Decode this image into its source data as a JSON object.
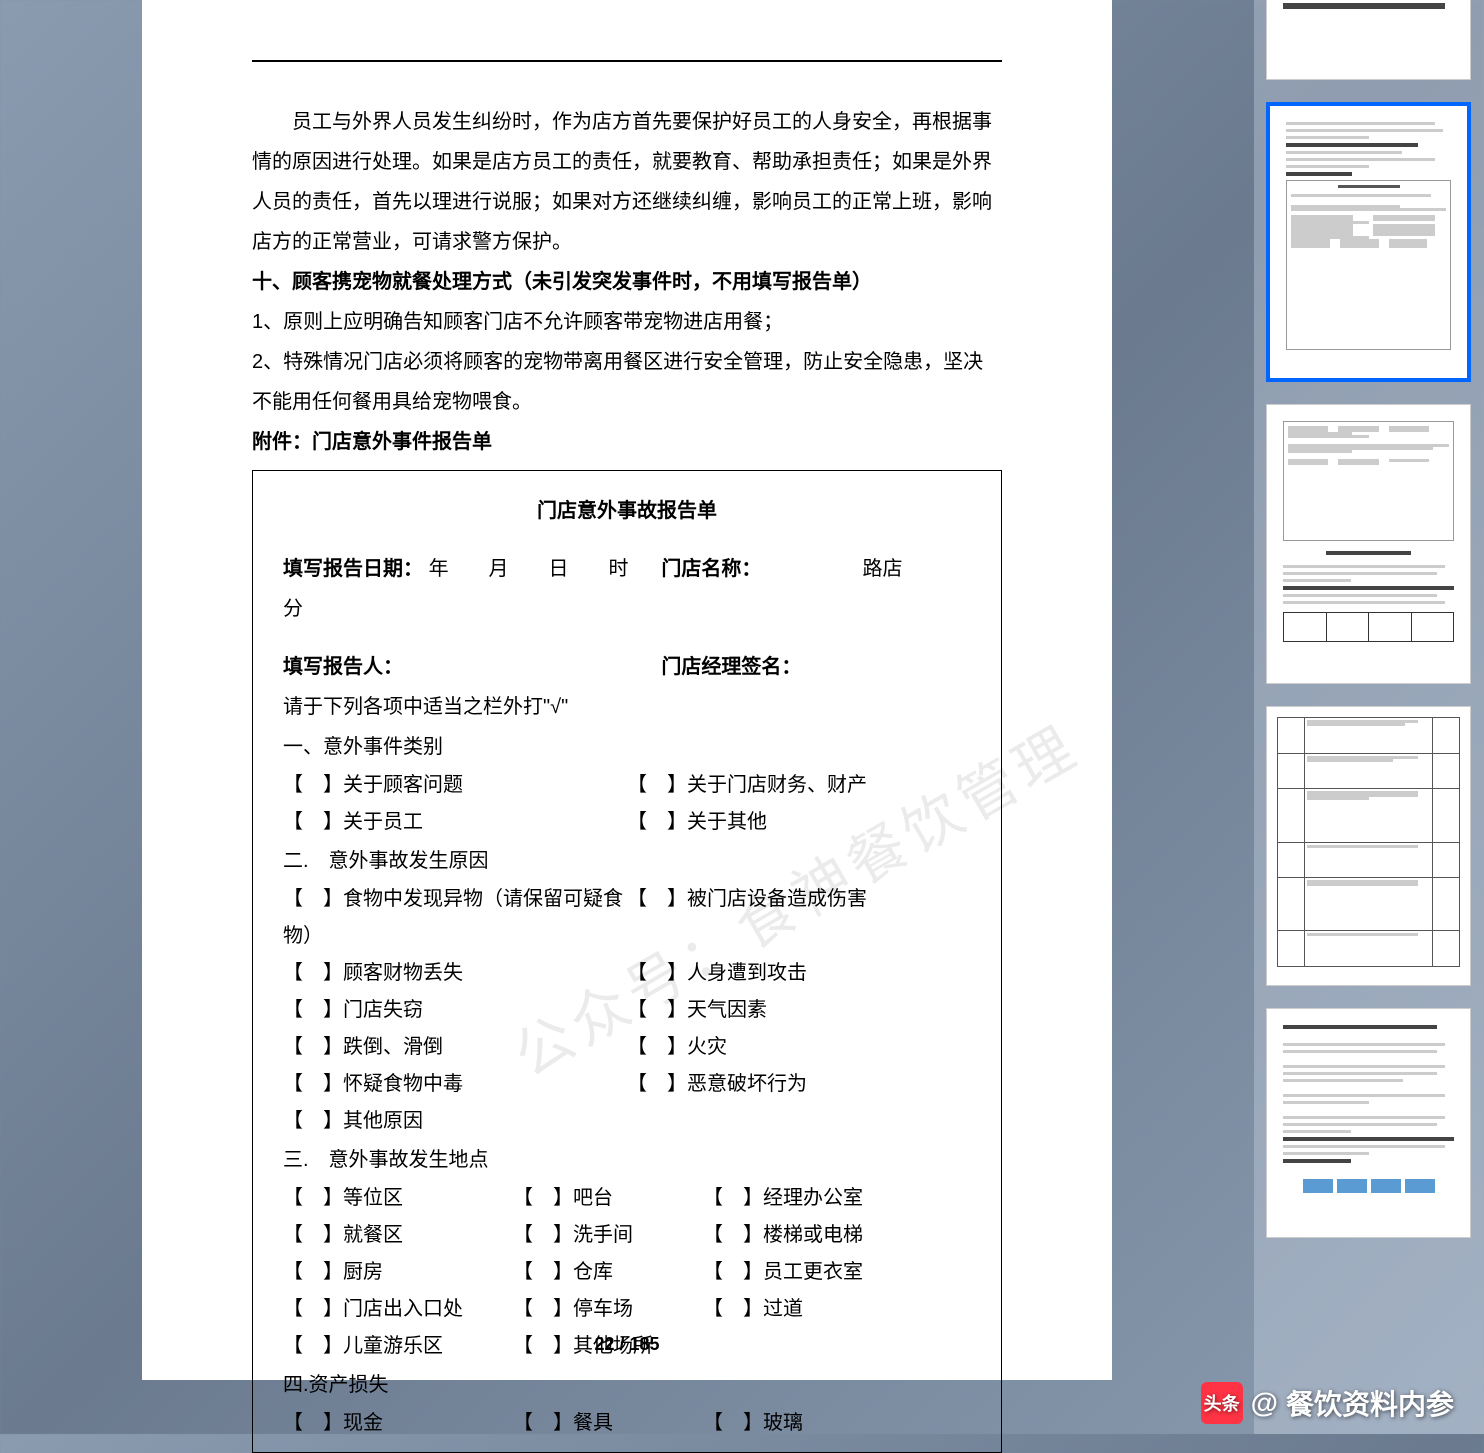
{
  "page": {
    "paragraph1": "员工与外界人员发生纠纷时，作为店方首先要保护好员工的人身安全，再根据事情的原因进行处理。如果是店方员工的责任，就要教育、帮助承担责任；如果是外界人员的责任，首先以理进行说服；如果对方还继续纠缠，影响员工的正常上班，影响店方的正常营业，可请求警方保护。",
    "heading10": "十、顾客携宠物就餐处理方式（未引发突发事件时，不用填写报告单）",
    "item1": "1、原则上应明确告知顾客门店不允许顾客带宠物进店用餐；",
    "item2": "2、特殊情况门店必须将顾客的宠物带离用餐区进行安全管理，防止安全隐患，坚决不能用任何餐用具给宠物喂食。",
    "attach_label": "附件：门店意外事件报告单",
    "form": {
      "title": "门店意外事故报告单",
      "date_label": "填写报告日期：",
      "date_fields": "年　　月　　日　　时　分",
      "store_label": "门店名称：",
      "store_suffix": "路店",
      "reporter_label": "填写报告人：",
      "manager_label": "门店经理签名：",
      "instruction": "请于下列各项中适当之栏外打\"√\"",
      "sec1": "一、意外事件类别",
      "s1a": "【　】关于顾客问题",
      "s1b": "【　】关于门店财务、财产",
      "s1c": "【　】关于员工",
      "s1d": "【　】关于其他",
      "sec2": "二.　意外事故发生原因",
      "s2a": "【　】食物中发现异物（请保留可疑食物）",
      "s2b": "【　】被门店设备造成伤害",
      "s2c": "【　】顾客财物丢失",
      "s2d": "【　】人身遭到攻击",
      "s2e": "【　】门店失窃",
      "s2f": "【　】天气因素",
      "s2g": "【　】跌倒、滑倒",
      "s2h": "【　】火灾",
      "s2i": "【　】怀疑食物中毒",
      "s2j": "【　】恶意破坏行为",
      "s2k": "【　】其他原因",
      "sec3": "三.　意外事故发生地点",
      "s3a": "【　】等位区",
      "s3b": "【　】吧台",
      "s3c": "【　】经理办公室",
      "s3d": "【　】就餐区",
      "s3e": "【　】洗手间",
      "s3f": "【　】楼梯或电梯",
      "s3g": "【　】厨房",
      "s3h": "【　】仓库",
      "s3i": "【　】员工更衣室",
      "s3j": "【　】门店出入口处",
      "s3k": "【　】停车场",
      "s3l": "【　】过道",
      "s3m": "【　】儿童游乐区",
      "s3n": "【　】其他场所",
      "sec4": "四.资产损失",
      "s4a": "【　】现金",
      "s4b": "【　】餐具",
      "s4c": "【　】玻璃"
    },
    "page_number": "22 / 185"
  },
  "watermark": "公众号：食神餐饮管理",
  "attribution": {
    "prefix": "头条",
    "at": "@",
    "name": "餐饮资料内参"
  }
}
